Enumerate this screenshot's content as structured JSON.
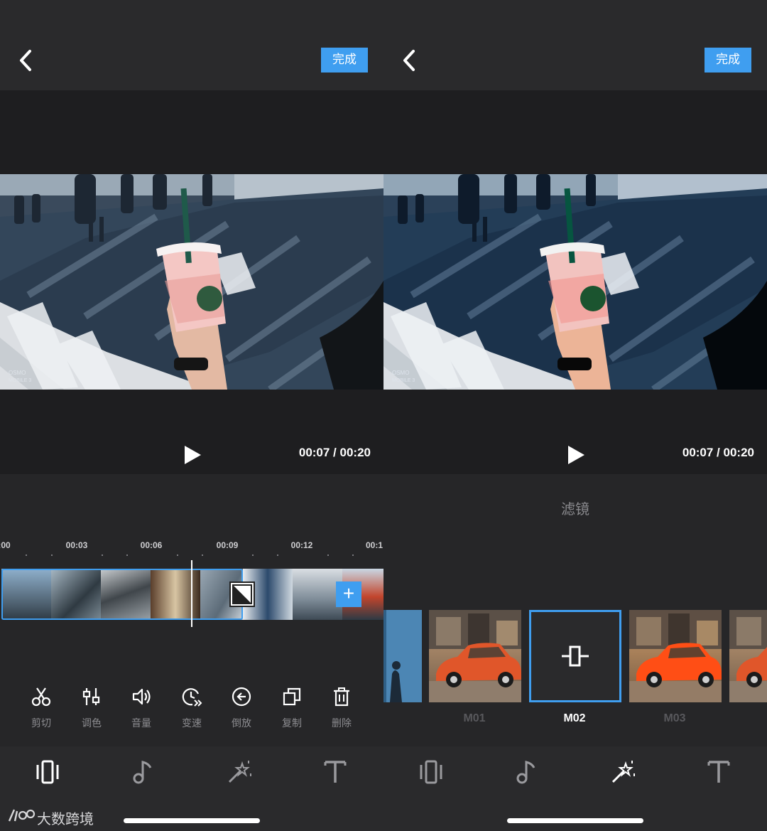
{
  "left": {
    "header": {
      "done_label": "完成"
    },
    "player": {
      "time": "00:07 / 00:20"
    },
    "ruler": {
      "labels": [
        ":00",
        "00:03",
        "00:06",
        "00:09",
        "00:12",
        "00:1"
      ]
    },
    "tools": [
      {
        "label": "剪切",
        "icon": "scissors-icon"
      },
      {
        "label": "调色",
        "icon": "adjust-color-icon"
      },
      {
        "label": "音量",
        "icon": "volume-icon"
      },
      {
        "label": "变速",
        "icon": "speed-icon"
      },
      {
        "label": "倒放",
        "icon": "reverse-icon"
      },
      {
        "label": "复制",
        "icon": "copy-icon"
      },
      {
        "label": "删除",
        "icon": "trash-icon"
      }
    ],
    "nav": [
      "clips-icon",
      "music-icon",
      "effects-icon",
      "text-icon"
    ],
    "watermark": "大数跨境"
  },
  "right": {
    "header": {
      "done_label": "完成"
    },
    "player": {
      "time": "00:07 / 00:20"
    },
    "filter_title": "滤镜",
    "filters": [
      "M01",
      "M02",
      "M03"
    ],
    "selected_filter": "M02",
    "nav": [
      "clips-icon",
      "music-icon",
      "effects-icon",
      "text-icon"
    ]
  },
  "colors": {
    "accent": "#3f9ef0",
    "background": "#262628",
    "bar": "#2a2a2c"
  }
}
